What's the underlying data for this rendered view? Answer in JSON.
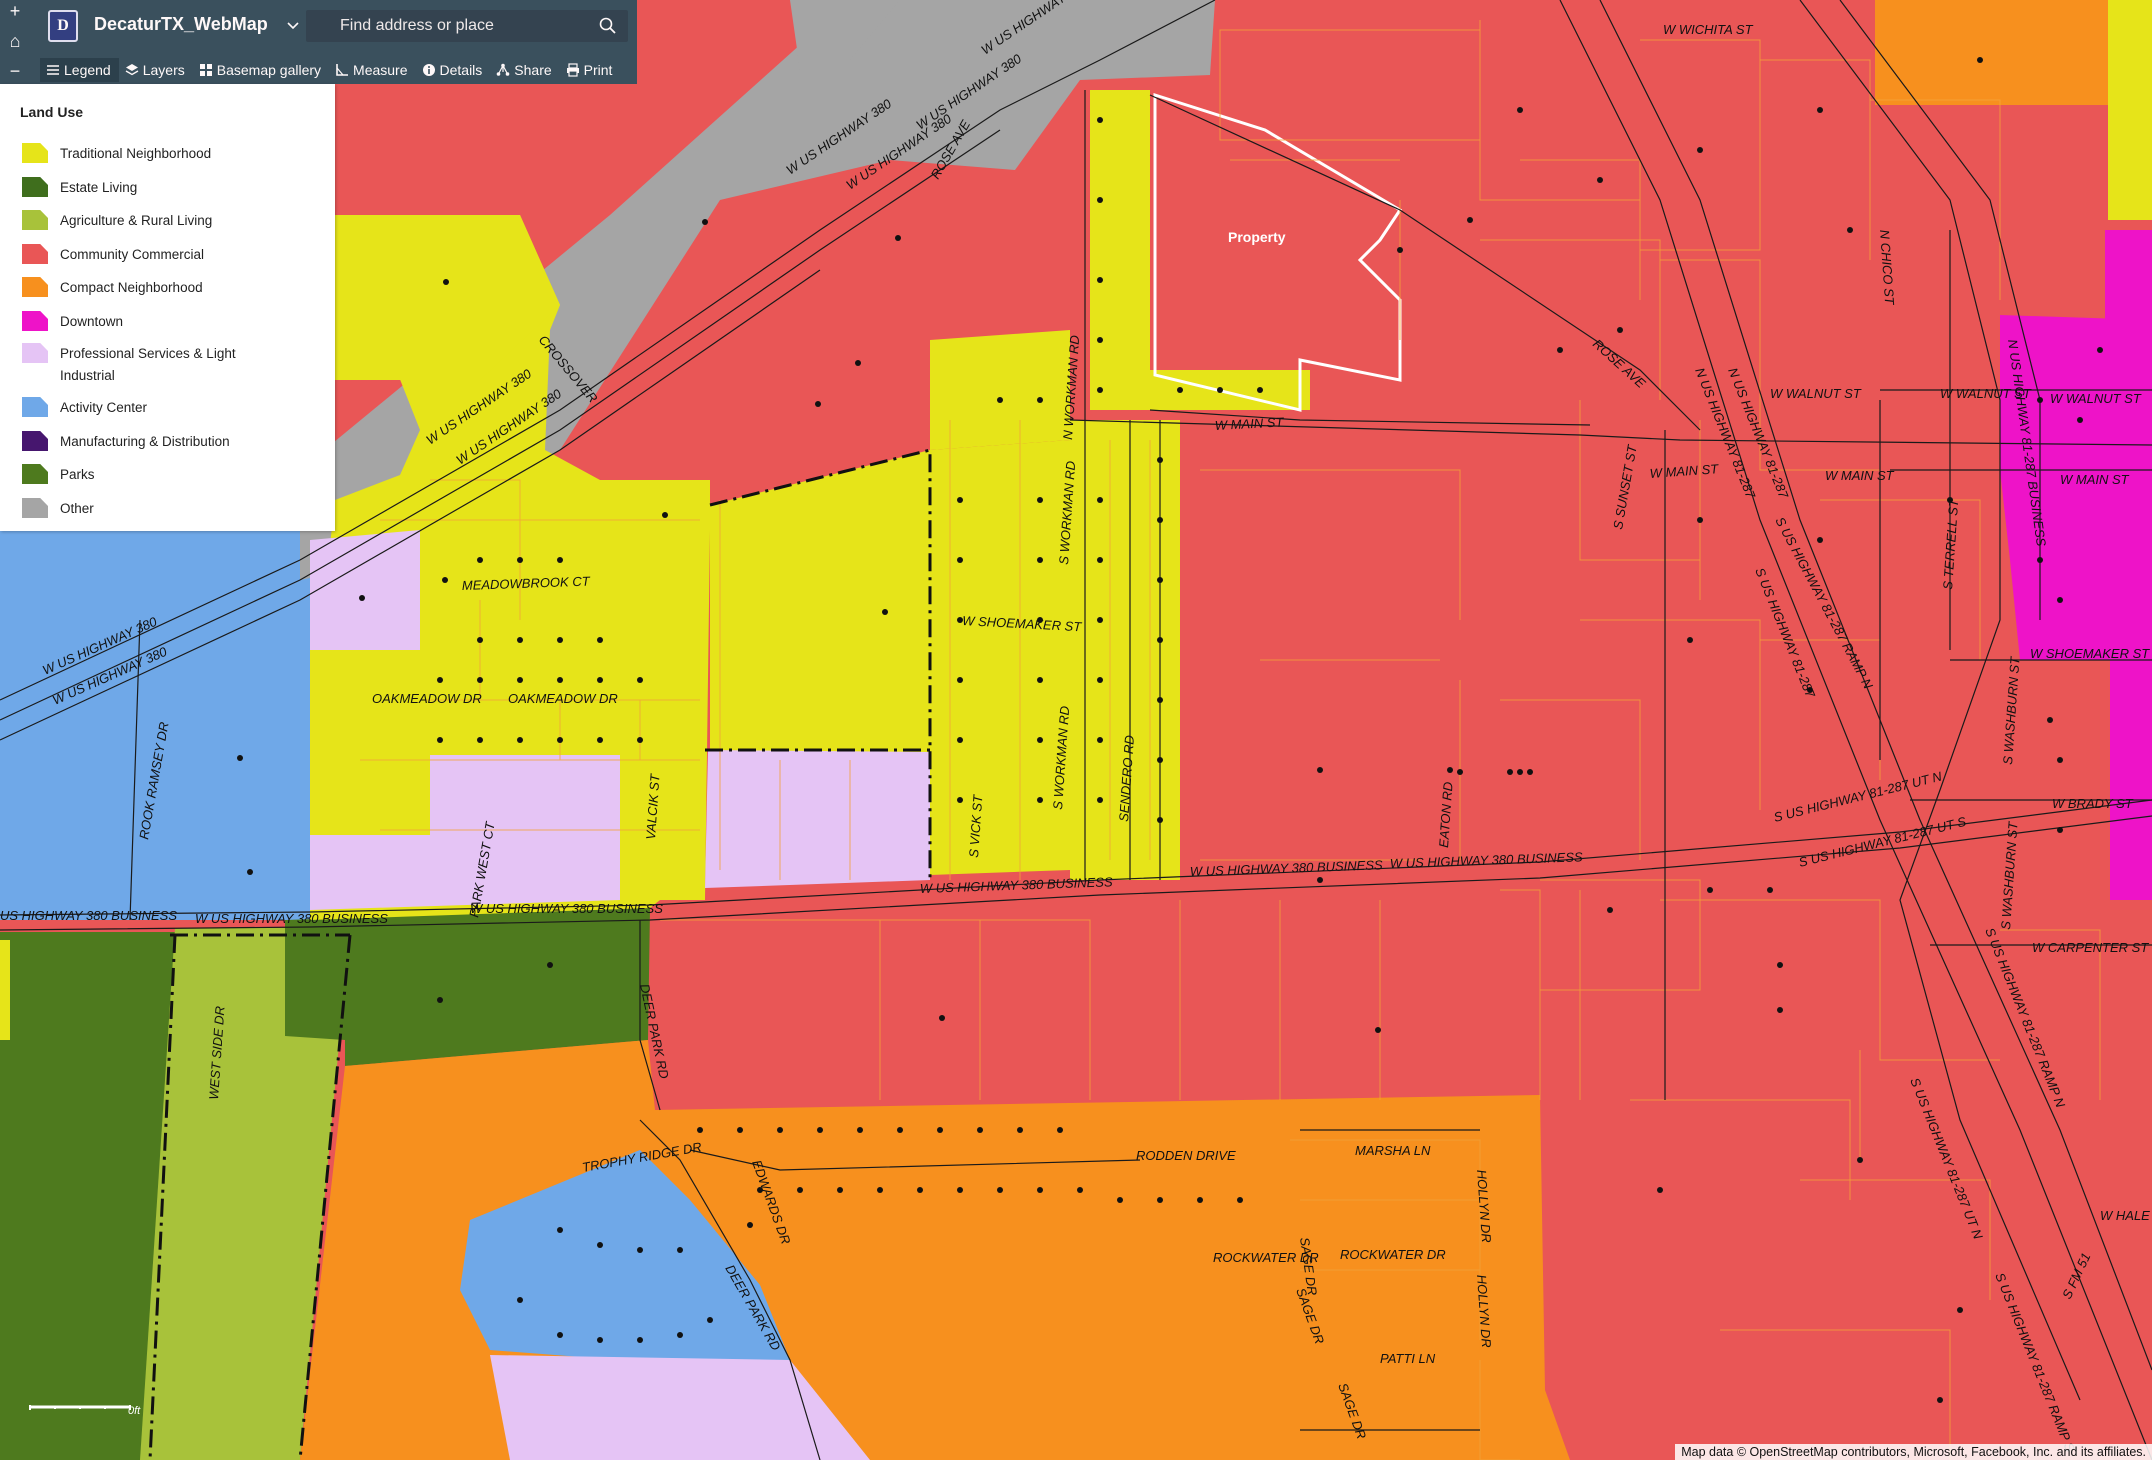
{
  "app": {
    "title": "DecaturTX_WebMap",
    "logo_letter": "D"
  },
  "search": {
    "placeholder": "Find address or place"
  },
  "zoom": {
    "in": "+",
    "home": "⌂",
    "out": "−"
  },
  "toolbar": [
    {
      "name": "legend",
      "label": "Legend"
    },
    {
      "name": "layers",
      "label": "Layers"
    },
    {
      "name": "basemap",
      "label": "Basemap gallery"
    },
    {
      "name": "measure",
      "label": "Measure"
    },
    {
      "name": "details",
      "label": "Details"
    },
    {
      "name": "share",
      "label": "Share"
    },
    {
      "name": "print",
      "label": "Print"
    }
  ],
  "legend": {
    "title": "Land Use",
    "items": [
      {
        "label": "Traditional Neighborhood",
        "color": "#e6e419"
      },
      {
        "label": "Estate Living",
        "color": "#3f6e1d"
      },
      {
        "label": "Agriculture & Rural Living",
        "color": "#a8c23a"
      },
      {
        "label": "Community Commercial",
        "color": "#e95656"
      },
      {
        "label": "Compact Neighborhood",
        "color": "#f7901e"
      },
      {
        "label": "Downtown",
        "color": "#ee13c8"
      },
      {
        "label": "Professional Services & Light Industrial",
        "color": "#e5c4f5"
      },
      {
        "label": "Activity Center",
        "color": "#6fa8e8"
      },
      {
        "label": "Manufacturing & Distribution",
        "color": "#46166e"
      },
      {
        "label": "Parks",
        "color": "#4e7a1e"
      },
      {
        "label": "Other",
        "color": "#a5a5a5"
      }
    ]
  },
  "map_labels": {
    "property": "Property",
    "w_wichita_st": "W WICHITA ST",
    "w_walnut_st_1": "W WALNUT ST",
    "w_walnut_st_2": "W WALNUT ST",
    "w_walnut_st_3": "W WALNUT ST",
    "w_main_st_1": "W MAIN ST",
    "w_main_st_2": "W MAIN ST",
    "w_main_st_3": "W MAIN ST",
    "w_main_st_4": "W MAIN ST",
    "w_shoemaker_st_1": "W SHOEMAKER ST",
    "w_shoemaker_st_2": "W SHOEMAKER ST",
    "w_brady_st": "W BRADY ST",
    "w_carpenter_st": "W CARPENTER ST",
    "w_hale": "W HALE",
    "hwy380_1": "W US HIGHWAY 380",
    "hwy380_2": "W US HIGHWAY 380",
    "hwy380_3": "W US HIGHWAY 380",
    "hwy380_4": "W US HIGHWAY 380",
    "hwy380_5": "W US HIGHWAY 380",
    "hwy380_6": "W US HIGHWAY 380",
    "hwy380_7": "W US HIGHWAY 380",
    "hwy380_8": "W US HIGHWAY 380",
    "bus380_1": "US HIGHWAY 380 BUSINESS",
    "bus380_2": "W US HIGHWAY 380 BUSINESS",
    "bus380_3": "W US HIGHWAY 380 BUSINESS",
    "bus380_4": "W US HIGHWAY 380 BUSINESS",
    "bus380_5": "W US HIGHWAY 380 BUSINESS",
    "bus380_6": "W US HIGHWAY 380 BUSINESS",
    "crossover": "CROSSOVER",
    "rose_ave_1": "ROSE AVE",
    "rose_ave_2": "ROSE AVE",
    "n_workman_rd": "N WORKMAN RD",
    "s_workman_rd_1": "S WORKMAN RD",
    "s_workman_rd_2": "S WORKMAN RD",
    "sendero_rd": "SENDERO RD",
    "s_vick_st": "S VICK ST",
    "meadowbrook_ct": "MEADOWBROOK CT",
    "oakmeadow_dr_1": "OAKMEADOW DR",
    "oakmeadow_dr_2": "OAKMEADOW DR",
    "valcik_st": "VALCIK ST",
    "park_west_ct": "PARK WEST CT",
    "rook_ramsey_dr": "ROOK RAMSEY DR",
    "west_side_dr": "WEST SIDE DR",
    "deer_park_rd_1": "DEER PARK RD",
    "deer_park_rd_2": "DEER PARK RD",
    "trophy_ridge_dr": "TROPHY RIDGE DR",
    "edwards_dr": "EDWARDS DR",
    "rodden_drive": "RODDEN DRIVE",
    "marsha_ln": "MARSHA LN",
    "sage_dr_1": "SAGE DR",
    "sage_dr_2": "SAGE DR",
    "sage_dr_3": "SAGE DR",
    "rockwater_dr_1": "ROCKWATER DR",
    "rockwater_dr_2": "ROCKWATER DR",
    "hollyn_dr_1": "HOLLYN DR",
    "hollyn_dr_2": "HOLLYN DR",
    "patti_ln": "PATTI LN",
    "eaton_rd": "EATON RD",
    "n_chico_st": "N CHICO ST",
    "s_sunset_st": "S SUNSET ST",
    "s_terrell_st": "S TERRELL ST",
    "s_washburn_st_1": "S WASHBURN ST",
    "s_washburn_st_2": "S WASHBURN ST",
    "n_us_hwy_81_287_1": "N US HIGHWAY 81-287",
    "n_us_hwy_81_287_2": "N US HIGHWAY 81-287",
    "n_us_hwy_81_287_bus": "N US HIGHWAY 81-287 BUSINESS",
    "s_us_hwy_81_287": "S US HIGHWAY 81-287",
    "s_us_hwy_81_287_ramp_n": "S US HIGHWAY 81-287 RAMP N",
    "s_us_hwy_81_287_ramp_n2": "S US HIGHWAY 81-287 RAMP N",
    "s_us_hwy_81_287_ut_n": "S US HIGHWAY 81-287 UT N",
    "s_us_hwy_81_287_ut_s": "S US HIGHWAY 81-287 UT S",
    "s_us_hwy_81_287_ut_n2": "S US HIGHWAY 81-287 UT N",
    "s_us_hwy_81_287_ramp_s": "S US HIGHWAY 81-287 RAMP S",
    "s_fm_51": "S FM 51"
  },
  "scale": {
    "label": "0ft"
  },
  "attribution": "Map data © OpenStreetMap contributors, Microsoft, Facebook, Inc. and its affiliates."
}
